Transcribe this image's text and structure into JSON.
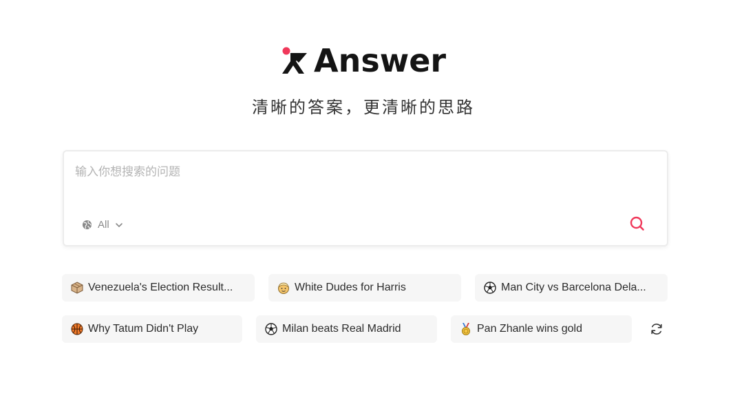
{
  "brand": {
    "name": "Answer",
    "tagline": "清晰的答案，更清晰的思路",
    "accent_color": "#f0385a"
  },
  "search": {
    "placeholder": "输入你想搜索的问题",
    "value": "",
    "scope_label": "All",
    "scope_icon": "globe-icon",
    "submit_icon": "search-icon"
  },
  "suggestions": [
    {
      "icon": "package-emoji",
      "label": "Venezuela's Election Result..."
    },
    {
      "icon": "person-emoji",
      "label": "White Dudes for Harris"
    },
    {
      "icon": "soccer-emoji",
      "label": "Man City vs Barcelona Dela..."
    },
    {
      "icon": "basketball-emoji",
      "label": "Why Tatum Didn't Play"
    },
    {
      "icon": "soccer-emoji",
      "label": "Milan beats Real Madrid"
    },
    {
      "icon": "medal-emoji",
      "label": "Pan Zhanle wins gold"
    }
  ],
  "refresh_icon": "refresh-icon"
}
